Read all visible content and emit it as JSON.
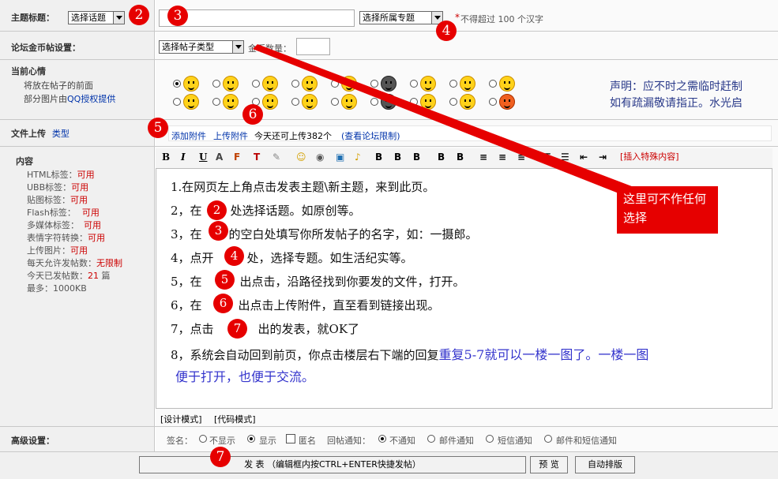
{
  "subject_row": {
    "label": "主题标题：",
    "topic_select": "选择话题",
    "special_select": "选择所属专题",
    "required_mark": "*",
    "hint": "不得超过  100 个汉字"
  },
  "gold_row": {
    "label": "论坛金币帖设置：",
    "type_select": "选择帖子类型",
    "amount_label": "金币数量："
  },
  "mood_row": {
    "label": "当前心情",
    "desc_line1": "将放在帖子的前面",
    "desc_line2_prefix": "部分图片由",
    "desc_line2_link": "QQ授权提供",
    "notice_line1": "声明：应不时之需临时赶制",
    "notice_line2": "如有疏漏敬请指正。水光启"
  },
  "upload_row": {
    "label": "文件上传",
    "type_link": "类型",
    "add_link": "添加附件",
    "upload_link": "上传附件",
    "quota_text": "今天还可上传382个",
    "limit_link": "(查看论坛限制)"
  },
  "content_row": {
    "label": "内容",
    "specs": [
      {
        "name": "HTML标签：",
        "value": "可用"
      },
      {
        "name": "UBB标签：",
        "value": "可用"
      },
      {
        "name": "贴图标签：",
        "value": "可用"
      },
      {
        "name": "Flash标签：",
        "value": "可用"
      },
      {
        "name": "多媒体标签：",
        "value": "可用"
      },
      {
        "name": "表情字符转换：",
        "value": "可用"
      },
      {
        "name": "上传图片：",
        "value": "可用"
      },
      {
        "name": "每天允许发帖数：",
        "value": "无限制"
      }
    ],
    "today_posts_label": "今天已发帖数：",
    "today_posts_value": "21",
    "today_posts_unit": "篇",
    "max_size": "最多：1000KB"
  },
  "toolbar": {
    "insert_special": "[插入特殊内容]",
    "bold_b": "B",
    "italic_i": "I",
    "underline_u": "U"
  },
  "editor": {
    "lines": [
      "1.在网页左上角点击发表主题\\新主题，来到此页。",
      "2，在",
      "处选择话题。如原创等。",
      "3，在",
      "的空白处填写你所发帖子的名字，如：一摄郎。",
      "4，点开",
      "处，选择专题。如生活纪实等。",
      "5，在",
      "出点击，沿路径找到你要发的文件，打开。",
      "6，在",
      "出点击上传附件，直至看到链接出现。",
      "7，点击",
      "出的发表，就OK了",
      "8，系统会自动回到前页，你点击楼层右下端的回复",
      "重复5-7就可以一楼一图了。一楼一图",
      "便于打开，也便于交流。"
    ],
    "mode_design": "[设计模式]",
    "mode_code": "[代码模式]"
  },
  "annotation": {
    "callout": "这里可不作任何选择",
    "badges": [
      "2",
      "3",
      "4",
      "6",
      "5",
      "7"
    ],
    "inline_badges": [
      "2",
      "3",
      "4",
      "5",
      "6",
      "7"
    ]
  },
  "advanced_row": {
    "label": "高级设置：",
    "signature_label": "签名：",
    "sig_hide": "不显示",
    "sig_show": "显示",
    "anonymous": "匿名",
    "reply_notify_label": "回帖通知：",
    "no_notify": "不通知",
    "mail_notify": "邮件通知",
    "sms_notify": "短信通知",
    "both_notify": "邮件和短信通知"
  },
  "submit_row": {
    "submit_btn": "发 表 （编辑框内按CTRL+ENTER快捷发帖）",
    "preview_btn": "预 览",
    "auto_format_btn": "自动排版"
  },
  "colors": {
    "badge": "#e60000",
    "callout_bg": "#e60000",
    "link": "#0033aa"
  }
}
